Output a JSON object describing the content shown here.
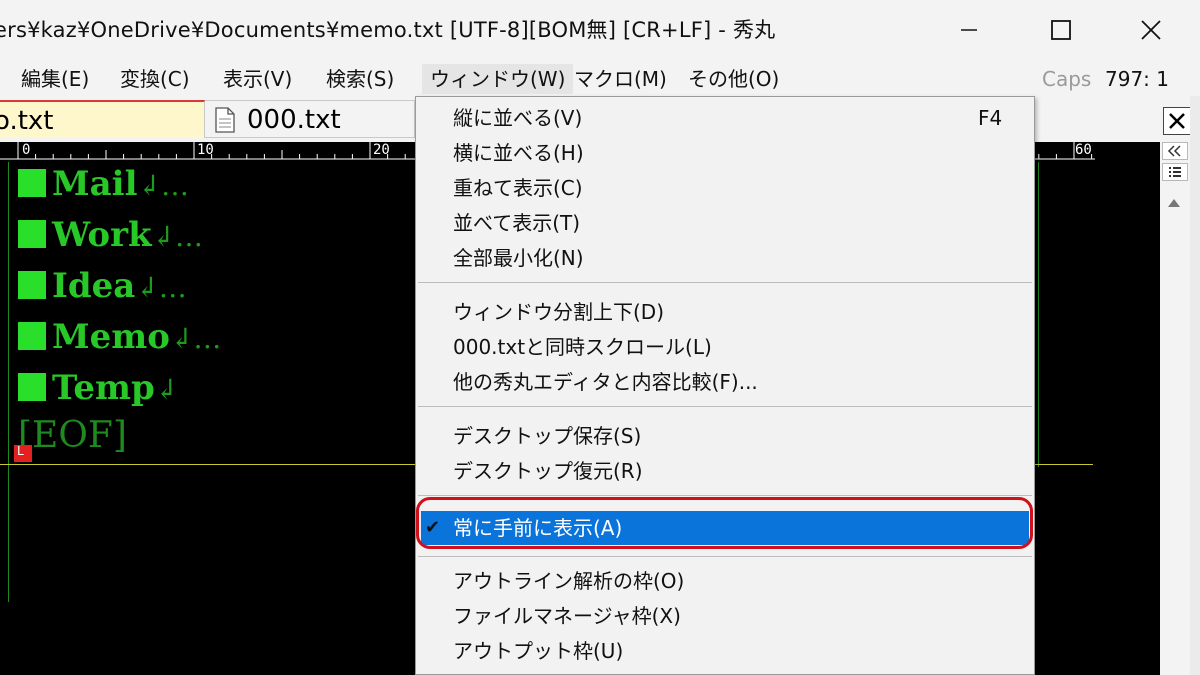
{
  "window": {
    "title": "ers¥kaz¥OneDrive¥Documents¥memo.txt  [UTF-8][BOM無] [CR+LF] - 秀丸"
  },
  "menubar": {
    "items": [
      {
        "label": "編集(E)"
      },
      {
        "label": "変換(C)"
      },
      {
        "label": "表示(V)"
      },
      {
        "label": "検索(S)"
      },
      {
        "label": "ウィンドウ(W)"
      },
      {
        "label": "マクロ(M)"
      },
      {
        "label": "その他(O)"
      }
    ],
    "caps": "Caps",
    "cursor_position": "797: 1"
  },
  "tabs": [
    {
      "label": "o.txt"
    },
    {
      "label": "000.txt"
    }
  ],
  "ruler": {
    "numbers": [
      "0",
      "10",
      "20",
      "60"
    ]
  },
  "editor": {
    "lines": [
      {
        "text": "Mail",
        "ret": "↲…"
      },
      {
        "text": "Work",
        "ret": "↲…"
      },
      {
        "text": "Idea",
        "ret": "↲…"
      },
      {
        "text": "Memo",
        "ret": "↲…"
      },
      {
        "text": "Temp",
        "ret": "↲"
      }
    ],
    "eof": "[EOF]",
    "caret_mark": "L"
  },
  "dropdown": {
    "items": [
      {
        "label": "縦に並べる(V)",
        "shortcut": "F4"
      },
      {
        "label": "横に並べる(H)"
      },
      {
        "label": "重ねて表示(C)"
      },
      {
        "label": "並べて表示(T)"
      },
      {
        "label": "全部最小化(N)"
      },
      {
        "label": "ウィンドウ分割上下(D)"
      },
      {
        "label": "000.txtと同時スクロール(L)"
      },
      {
        "label": "他の秀丸エディタと内容比較(F)..."
      },
      {
        "label": "デスクトップ保存(S)"
      },
      {
        "label": "デスクトップ復元(R)"
      },
      {
        "label": "常に手前に表示(A)",
        "checked": true
      },
      {
        "label": "アウトライン解析の枠(O)"
      },
      {
        "label": "ファイルマネージャ枠(X)"
      },
      {
        "label": "アウトプット枠(U)"
      }
    ]
  },
  "colors": {
    "selection": "#0a74da",
    "highlight_ring": "#d0101a",
    "editor_text": "#28c828",
    "editor_bg": "#000000"
  },
  "icons": {
    "minimize": "minimize-icon",
    "maximize": "maximize-icon",
    "close": "close-icon",
    "file": "file-icon",
    "collapse": "double-chevron-left-icon",
    "list": "list-icon",
    "scroll_up": "arrow-up-icon"
  }
}
